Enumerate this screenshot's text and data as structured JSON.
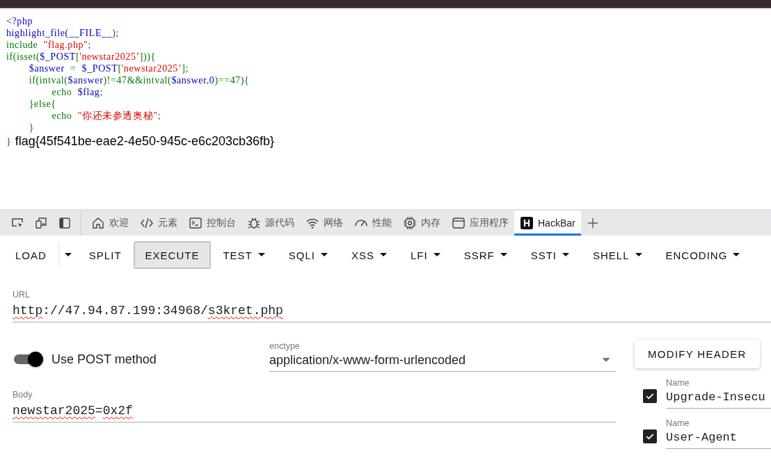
{
  "code": {
    "lines": [
      [
        {
          "kind": "default",
          "text": "<?php"
        }
      ],
      [
        {
          "kind": "default",
          "text": "highlight_file(__FILE__"
        },
        {
          "kind": "keyword",
          "text": ");"
        }
      ],
      [
        {
          "kind": "keyword",
          "text": "include  "
        },
        {
          "kind": "string",
          "text": "″flag.php″"
        },
        {
          "kind": "keyword",
          "text": ";"
        }
      ],
      [
        {
          "kind": "keyword",
          "text": "if(isset("
        },
        {
          "kind": "default",
          "text": "$_POST"
        },
        {
          "kind": "keyword",
          "text": "["
        },
        {
          "kind": "string",
          "text": "'newstar2025’"
        },
        {
          "kind": "keyword",
          "text": "])){"
        }
      ],
      [
        {
          "kind": "default",
          "text": "        $answer  "
        },
        {
          "kind": "keyword",
          "text": "=  "
        },
        {
          "kind": "default",
          "text": "$_POST"
        },
        {
          "kind": "keyword",
          "text": "["
        },
        {
          "kind": "string",
          "text": "'newstar2025’"
        },
        {
          "kind": "keyword",
          "text": "];"
        }
      ],
      [
        {
          "kind": "keyword",
          "text": "        if(intval("
        },
        {
          "kind": "default",
          "text": "$answer"
        },
        {
          "kind": "keyword",
          "text": ")!=47&&intval("
        },
        {
          "kind": "default",
          "text": "$answer"
        },
        {
          "kind": "keyword",
          "text": ","
        },
        {
          "kind": "default",
          "text": "0"
        },
        {
          "kind": "keyword",
          "text": ")==47){"
        }
      ],
      [
        {
          "kind": "keyword",
          "text": "                echo  "
        },
        {
          "kind": "default",
          "text": "$flag"
        },
        {
          "kind": "keyword",
          "text": ";"
        }
      ],
      [
        {
          "kind": "keyword",
          "text": "        }else{"
        }
      ],
      [
        {
          "kind": "keyword",
          "text": "                echo  "
        },
        {
          "kind": "string",
          "text": "″你还未参透奥秘″"
        },
        {
          "kind": "keyword",
          "text": ";"
        }
      ],
      [
        {
          "kind": "keyword",
          "text": "        }"
        }
      ]
    ],
    "last_line": {
      "brace": "}",
      "output": "flag{45f541be-eae2-4e50-945c-e6c203cb36fb}"
    }
  },
  "devtools": {
    "tabs": [
      {
        "label": "欢迎",
        "selected": false
      },
      {
        "label": "元素",
        "selected": false
      },
      {
        "label": "控制台",
        "selected": false
      },
      {
        "label": "源代码",
        "selected": false
      },
      {
        "label": "网络",
        "selected": false
      },
      {
        "label": "性能",
        "selected": false
      },
      {
        "label": "内存",
        "selected": false
      },
      {
        "label": "应用程序",
        "selected": false
      },
      {
        "label": "HackBar",
        "selected": true
      }
    ]
  },
  "hackbar": {
    "buttons": [
      {
        "label": "LOAD",
        "kind": "split",
        "selected": false
      },
      {
        "label": "SPLIT",
        "kind": "plain",
        "selected": false
      },
      {
        "label": "EXECUTE",
        "kind": "plain",
        "selected": true
      },
      {
        "label": "TEST",
        "kind": "menu",
        "selected": false
      },
      {
        "label": "SQLI",
        "kind": "menu",
        "selected": false
      },
      {
        "label": "XSS",
        "kind": "menu",
        "selected": false
      },
      {
        "label": "LFI",
        "kind": "menu",
        "selected": false
      },
      {
        "label": "SSRF",
        "kind": "menu",
        "selected": false
      },
      {
        "label": "SSTI",
        "kind": "menu",
        "selected": false
      },
      {
        "label": "SHELL",
        "kind": "menu",
        "selected": false
      },
      {
        "label": "ENCODING",
        "kind": "menu",
        "selected": false
      }
    ],
    "url": {
      "label": "URL",
      "segments": [
        {
          "text": "http",
          "misspelled": true
        },
        {
          "text": "://47.94.87.199:34968/",
          "misspelled": false
        },
        {
          "text": "s3kret.php",
          "misspelled": true
        }
      ]
    },
    "post_toggle": {
      "label": "Use POST method",
      "on": true
    },
    "enctype": {
      "label": "enctype",
      "value": "application/x-www-form-urlencoded"
    },
    "body": {
      "label": "Body",
      "segments": [
        {
          "text": "newstar2025",
          "misspelled": true
        },
        {
          "text": "=",
          "misspelled": false
        },
        {
          "text": "0x2f",
          "misspelled": true
        }
      ]
    },
    "modify_header": "MODIFY HEADER",
    "headers": [
      {
        "label": "Name",
        "value": "Upgrade-Insecu",
        "checked": true
      },
      {
        "label": "Name",
        "value": "User-Agent",
        "checked": true
      }
    ]
  }
}
